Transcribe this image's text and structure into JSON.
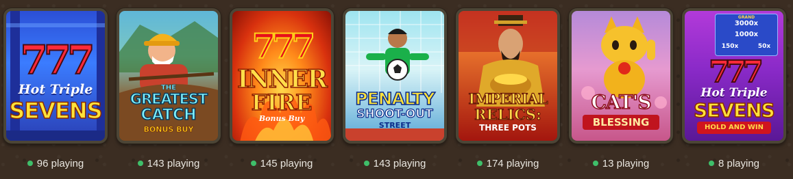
{
  "colors": {
    "background": "#3b2d22",
    "card_border": "#4c4536",
    "online_dot": "#3fbf6a",
    "count_text": "#e9e6df"
  },
  "games": [
    {
      "icon": "game-thumbnail-hot-triple-sevens",
      "logo_lines": [
        "777",
        "Hot Triple",
        "SEVENS"
      ],
      "players": "96 playing"
    },
    {
      "icon": "game-thumbnail-the-greatest-catch-bonus-buy",
      "logo_lines": [
        "THE",
        "GREATEST",
        "CATCH",
        "BONUS BUY"
      ],
      "players": "143 playing"
    },
    {
      "icon": "game-thumbnail-inner-fire-bonus-buy",
      "logo_lines": [
        "777",
        "INNER",
        "FIRE",
        "Bonus Buy"
      ],
      "players": "145 playing"
    },
    {
      "icon": "game-thumbnail-penalty-shoot-out-street",
      "logo_lines": [
        "PENALTY",
        "SHOOT-OUT",
        "STREET"
      ],
      "players": "143 playing"
    },
    {
      "icon": "game-thumbnail-imperial-relics-three-pots",
      "logo_lines": [
        "IMPERIAL",
        "RELICS:",
        "THREE POTS"
      ],
      "players": "174 playing"
    },
    {
      "icon": "game-thumbnail-cats-blessing",
      "logo_lines": [
        "CAT'S",
        "BLESSING"
      ],
      "players": "13 playing"
    },
    {
      "icon": "game-thumbnail-hot-triple-sevens-hold-and-win",
      "logo_lines": [
        "GRAND",
        "3000x",
        "1000x",
        "150x",
        "50x",
        "777",
        "Hot Triple",
        "SEVENS",
        "HOLD AND WIN"
      ],
      "players": "8 playing"
    }
  ]
}
